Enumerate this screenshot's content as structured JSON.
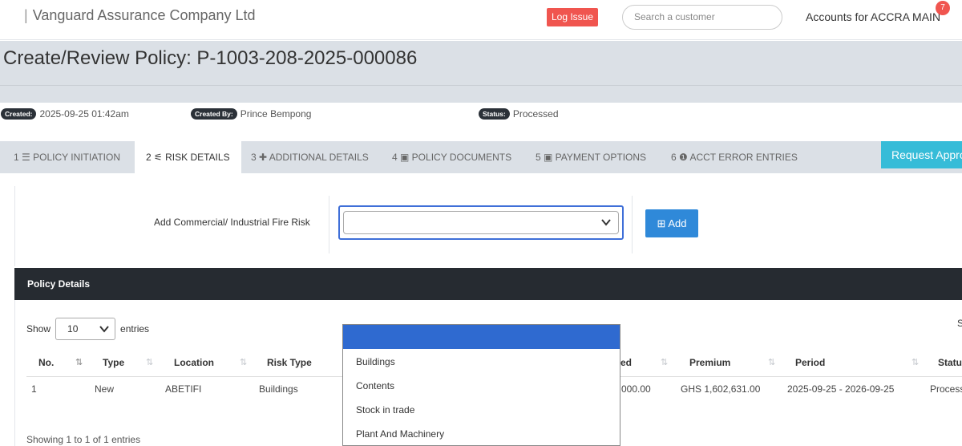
{
  "header": {
    "brand": "Vanguard Assurance Company Ltd",
    "brand_sep": "|",
    "log_issue": "Log Issue",
    "search_placeholder": "Search a customer",
    "accounts": "Accounts for ACCRA MAIN",
    "notification_count": "7"
  },
  "page": {
    "title": "Create/Review Policy: P-1003-208-2025-000086"
  },
  "meta": {
    "created_label": "Created:",
    "created_value": "2025-09-25 01:42am",
    "created_by_label": "Created By:",
    "created_by_value": "Prince Bempong",
    "status_label": "Status:",
    "status_value": "Processed"
  },
  "tabs": [
    {
      "label": "1 ☰ POLICY INITIATION"
    },
    {
      "label": "2 ⚟ RISK DETAILS",
      "active": true
    },
    {
      "label": "3 ✚ ADDITIONAL DETAILS"
    },
    {
      "label": "4 ▣ POLICY DOCUMENTS"
    },
    {
      "label": "5 ▣ PAYMENT OPTIONS"
    },
    {
      "label": "6 ❶ ACCT ERROR ENTRIES"
    }
  ],
  "request_button": "Request Appro",
  "risk_form": {
    "label": "Add Commercial/ Industrial Fire Risk",
    "selected": "",
    "add_button": "⊞ Add"
  },
  "panel": {
    "title": "Policy Details",
    "show_label": "Show",
    "entries_value": "10",
    "entries_label": "entries",
    "search_cut": "S",
    "columns": [
      "No.",
      "Type",
      "Location",
      "Risk Type",
      "ed",
      "Premium",
      "Period",
      "Status"
    ],
    "rows": [
      {
        "no": "1",
        "type": "New",
        "location": "ABETIFI",
        "risk_type": "Buildings",
        "sum_insured": "000.00",
        "premium": "GHS 1,602,631.00",
        "period": "2025-09-25 - 2026-09-25",
        "status": "Process"
      }
    ],
    "footer": "Showing 1 to 1 of 1 entries"
  },
  "dropdown": {
    "options": [
      "Buildings",
      "Contents",
      "Stock in trade",
      "Plant And Machinery"
    ]
  },
  "colors": {
    "accent_blue": "#2f89d9",
    "danger": "#f0554f",
    "info": "#36bcd8",
    "dark_panel": "#262b31"
  }
}
